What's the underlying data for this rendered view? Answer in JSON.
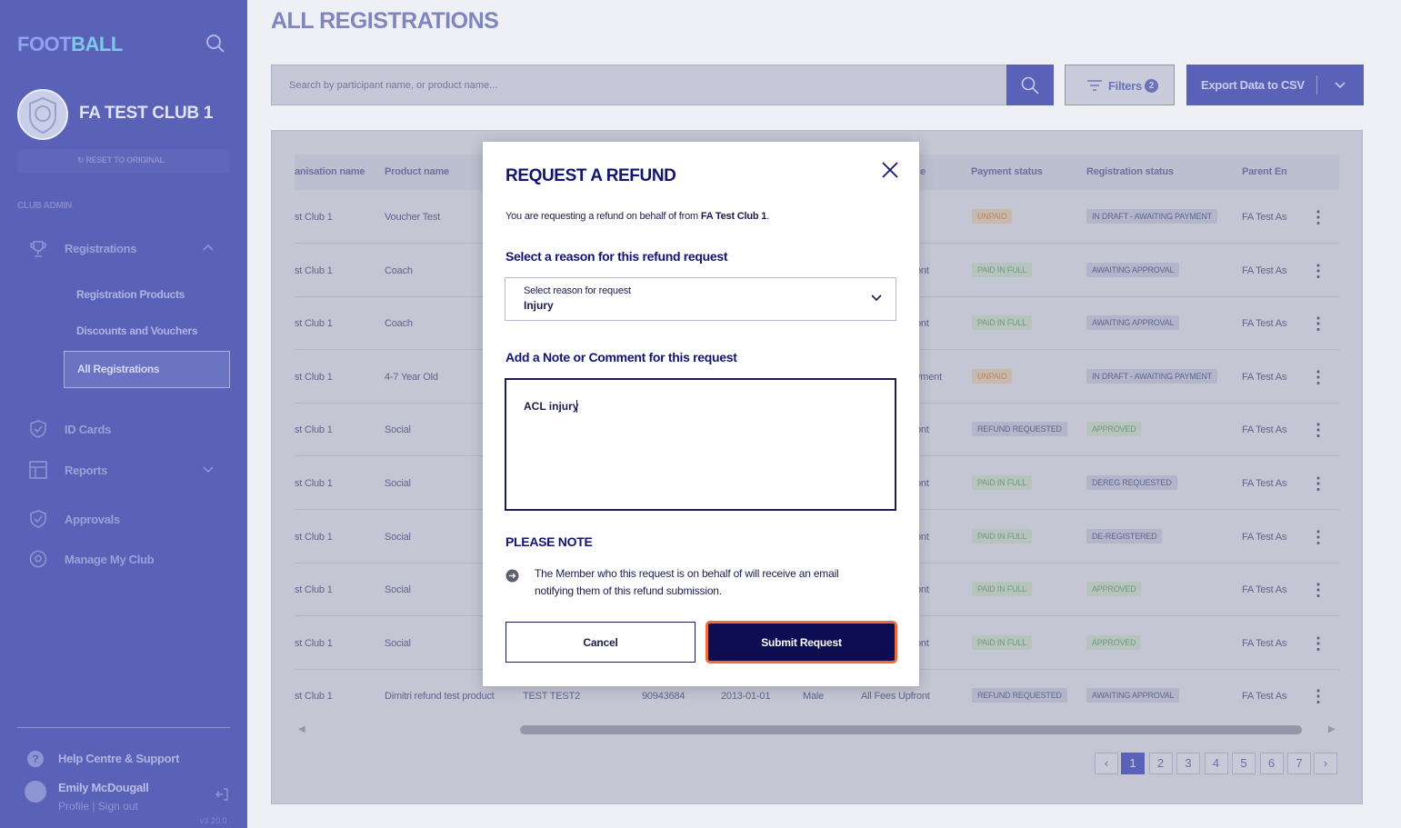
{
  "sidebar": {
    "logo_a": "FOOT",
    "logo_b": "BALL",
    "club_name": "FA TEST CLUB 1",
    "reset_label": "RESET TO ORIGINAL",
    "section_label": "CLUB ADMIN",
    "nav": {
      "registrations": "Registrations",
      "registration_products": "Registration Products",
      "discounts": "Discounts and Vouchers",
      "all_registrations": "All Registrations",
      "id_cards": "ID Cards",
      "reports": "Reports",
      "approvals": "Approvals",
      "manage_club": "Manage My Club"
    },
    "help": "Help Centre & Support",
    "user_name": "Emily McDougall",
    "user_links": "Profile | Sign out",
    "version": "v3.20.0"
  },
  "main": {
    "title": "ALL REGISTRATIONS",
    "search_placeholder": "Search by participant name, or product name...",
    "filters_label": "Filters",
    "filters_count": "2",
    "export_label": "Export Data to CSV"
  },
  "table": {
    "headers": {
      "org": "anisation name",
      "product": "Product name",
      "e": "e",
      "payment": "Payment status",
      "registration": "Registration status",
      "parent": "Parent Ent"
    },
    "rows": [
      {
        "org": "st Club 1",
        "product": "Voucher Test",
        "mid": "",
        "payment": "UNPAID",
        "registration": "IN DRAFT - AWAITING PAYMENT",
        "parent": "FA Test Ass"
      },
      {
        "org": "st Club 1",
        "product": "Coach",
        "mid": "ont",
        "payment": "PAID IN FULL",
        "registration": "AWAITING APPROVAL",
        "parent": "FA Test Ass"
      },
      {
        "org": "st Club 1",
        "product": "Coach",
        "mid": "ont",
        "payment": "PAID IN FULL",
        "registration": "AWAITING APPROVAL",
        "parent": "FA Test Ass"
      },
      {
        "org": "st Club 1",
        "product": "4-7 Year Old",
        "mid": "yment",
        "payment": "UNPAID",
        "registration": "IN DRAFT - AWAITING PAYMENT",
        "parent": "FA Test Ass"
      },
      {
        "org": "st Club 1",
        "product": "Social",
        "mid": "ont",
        "payment": "REFUND REQUESTED",
        "registration": "APPROVED",
        "parent": "FA Test Ass"
      },
      {
        "org": "st Club 1",
        "product": "Social",
        "mid": "ont",
        "payment": "PAID IN FULL",
        "registration": "DEREG REQUESTED",
        "parent": "FA Test Ass"
      },
      {
        "org": "st Club 1",
        "product": "Social",
        "mid": "ont",
        "payment": "PAID IN FULL",
        "registration": "DE-REGISTERED",
        "parent": "FA Test Ass"
      },
      {
        "org": "st Club 1",
        "product": "Social",
        "mid": "ont",
        "payment": "PAID IN FULL",
        "registration": "APPROVED",
        "parent": "FA Test Ass"
      },
      {
        "org": "st Club 1",
        "product": "Social",
        "mid": "ont",
        "payment": "PAID IN FULL",
        "registration": "APPROVED",
        "parent": "FA Test Ass"
      }
    ],
    "last_row": {
      "org": "st Club 1",
      "product": "Dimitri refund test product",
      "name": "TEST TEST2",
      "id": "90943684",
      "dob": "2013-01-01",
      "gender": "Male",
      "fees": "All Fees Upfront",
      "payment": "REFUND REQUESTED",
      "registration": "AWAITING APPROVAL",
      "parent": "FA Test Ass"
    },
    "pages": [
      "1",
      "2",
      "3",
      "4",
      "5",
      "6",
      "7"
    ],
    "prev": "‹",
    "next": "›"
  },
  "modal": {
    "title": "REQUEST A REFUND",
    "intro_prefix": "You are requesting a refund on behalf of  from ",
    "intro_club": "FA Test Club 1",
    "intro_suffix": ".",
    "reason_heading": "Select a reason for this refund request",
    "select_label": "Select reason for request",
    "select_value": "Injury",
    "note_heading": "Add a Note or Comment for this request",
    "note_value": "ACL injury",
    "please_note": "PLEASE NOTE",
    "note_text": "The Member who this request is on behalf of will receive an email notifying them of this refund submission.",
    "cancel_label": "Cancel",
    "submit_label": "Submit Request"
  },
  "colors": {
    "navy": "#121472",
    "submit_bg": "#0c0d52",
    "submit_border": "#f06b3b",
    "sidebar": "#5a62b8"
  }
}
